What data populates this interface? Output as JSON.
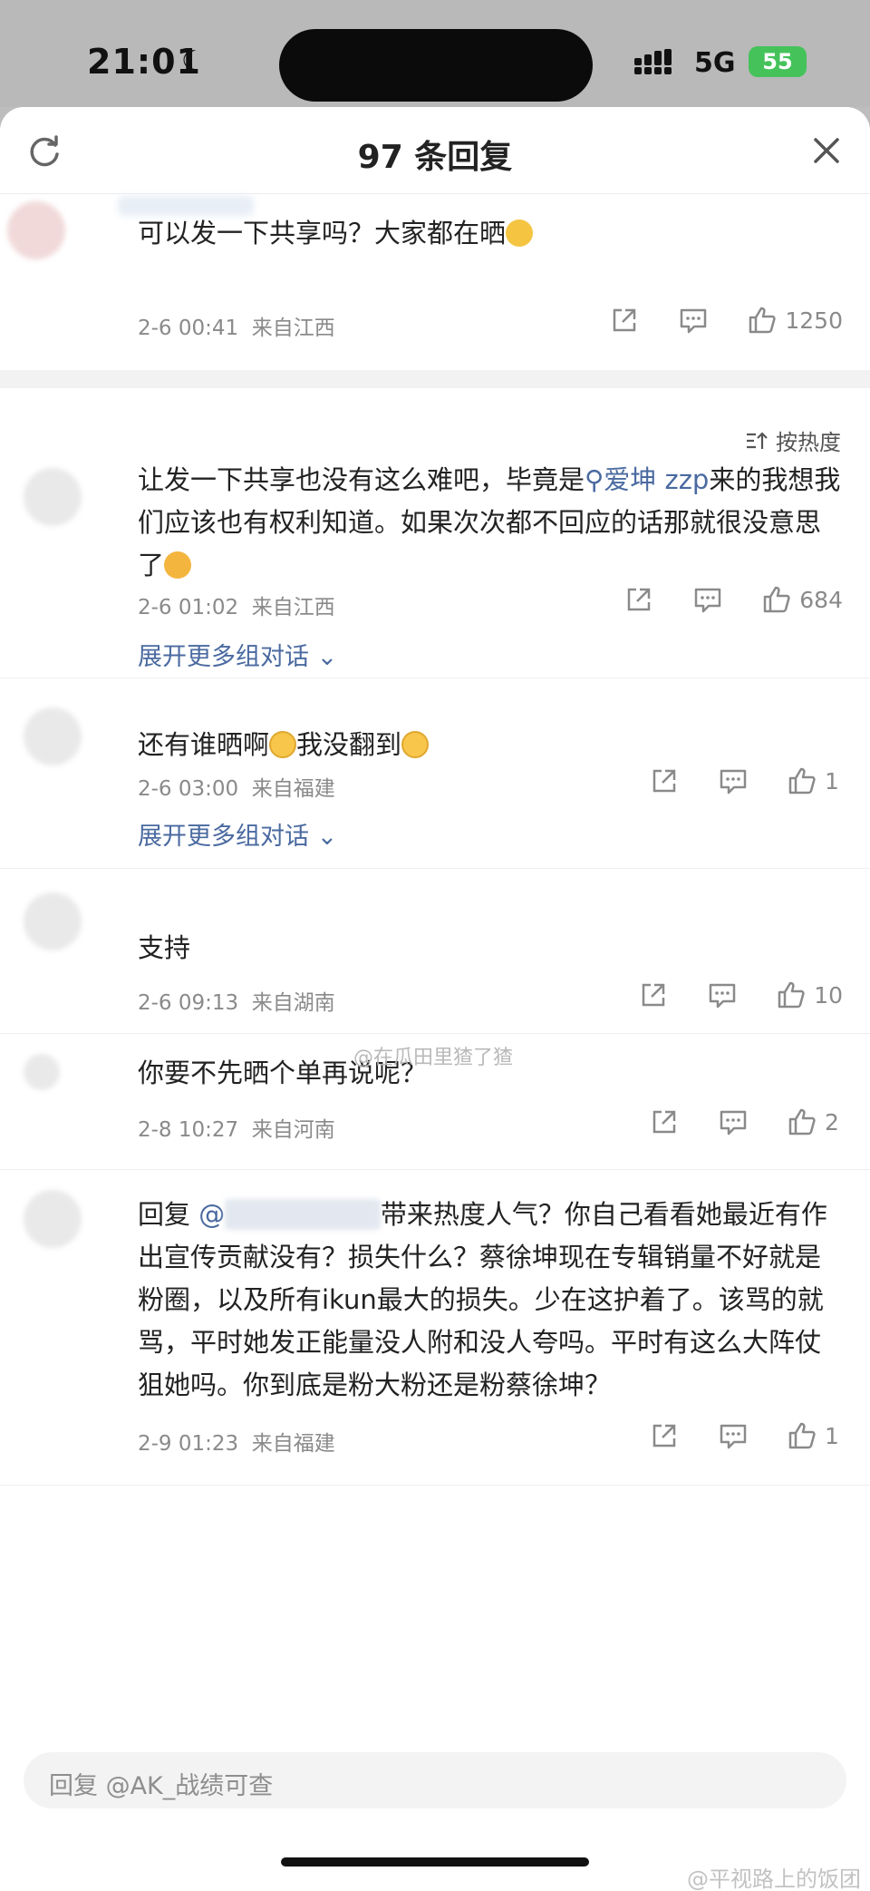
{
  "status_bar": {
    "time": "21:01",
    "network": "5G",
    "battery": "55"
  },
  "header": {
    "title": "97 条回复"
  },
  "pinned": {
    "text": "可以发一下共享吗？大家都在晒",
    "date": "2-6 00:41",
    "location": "来自江西",
    "likes": "1250"
  },
  "sort": {
    "label": "按热度"
  },
  "comments": [
    {
      "text_a": "让发一下共享也没有这么难吧，毕竟是",
      "mention": "爱坤 zzp",
      "text_b": "来的我想我们应该也有权利知道。如果次次都不回应的话那就很没意思了",
      "date": "2-6 01:02",
      "location": "来自江西",
      "likes": "684",
      "expand": "展开更多组对话"
    },
    {
      "text_a": "还有谁晒啊",
      "text_b": "我没翻到",
      "date": "2-6 03:00",
      "location": "来自福建",
      "likes": "1",
      "expand": "展开更多组对话"
    },
    {
      "text": "支持",
      "date": "2-6 09:13",
      "location": "来自湖南",
      "likes": "10"
    },
    {
      "text": "你要不先晒个单再说呢？",
      "date": "2-8 10:27",
      "location": "来自河南",
      "likes": "2"
    },
    {
      "prefix": "回复",
      "mention": "@",
      "text": "带来热度人气？你自己看看她最近有作出宣传贡献没有？损失什么？蔡徐坤现在专辑销量不好就是粉圈，以及所有ikun最大的损失。少在这护着了。该骂的就骂，平时她发正能量没人附和没人夸吗。平时有这么大阵仗狙她吗。你到底是粉大粉还是粉蔡徐坤？",
      "date": "2-9 01:23",
      "location": "来自福建",
      "likes": "1"
    }
  ],
  "watermarks": {
    "middle": "@在瓜田里猹了猹",
    "bottom": "@平视路上的饭团"
  },
  "reply_bar": {
    "placeholder": "回复 @AK_战绩可查"
  },
  "colors": {
    "link": "#4a6aa0",
    "meta": "#8a8a8a",
    "battery": "#45c35a"
  }
}
